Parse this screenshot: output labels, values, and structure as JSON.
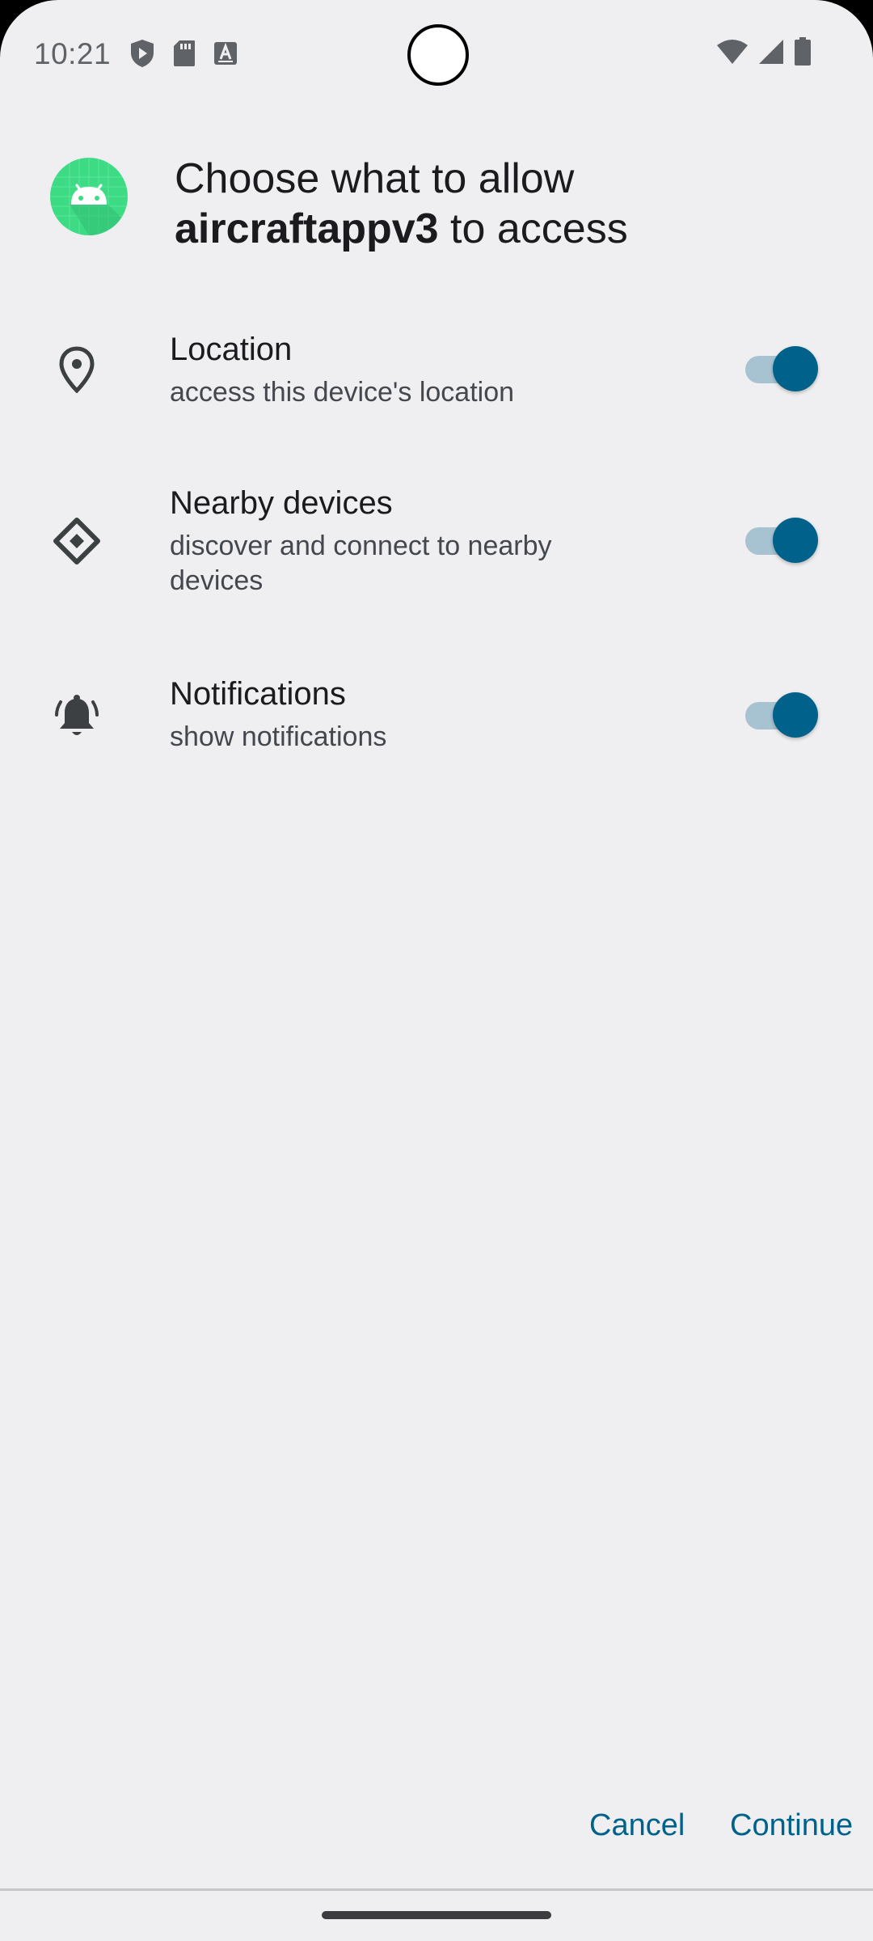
{
  "status_bar": {
    "time": "10:21",
    "left_icons": [
      "shield-play-icon",
      "sd-card-icon",
      "keyboard-a-icon"
    ],
    "right_icons": [
      "wifi-icon",
      "cellular-signal-icon",
      "battery-icon"
    ]
  },
  "header": {
    "title_prefix": "Choose what to allow",
    "app_name": "aircraftappv3",
    "title_suffix": " to access",
    "app_icon": "android-app-icon"
  },
  "permissions": [
    {
      "title": "Location",
      "subtitle": "access this device's location",
      "icon": "location-pin-icon",
      "enabled": true
    },
    {
      "title": "Nearby devices",
      "subtitle": "discover and connect to nearby devices",
      "icon": "nearby-devices-icon",
      "enabled": true
    },
    {
      "title": "Notifications",
      "subtitle": "show notifications",
      "icon": "bell-icon",
      "enabled": true
    }
  ],
  "buttons": {
    "cancel": "Cancel",
    "continue": "Continue"
  },
  "colors": {
    "accent": "#00628b",
    "switch_track": "#a7c2d1",
    "background": "#efeff1",
    "app_icon_bg": "#3ddc84"
  }
}
